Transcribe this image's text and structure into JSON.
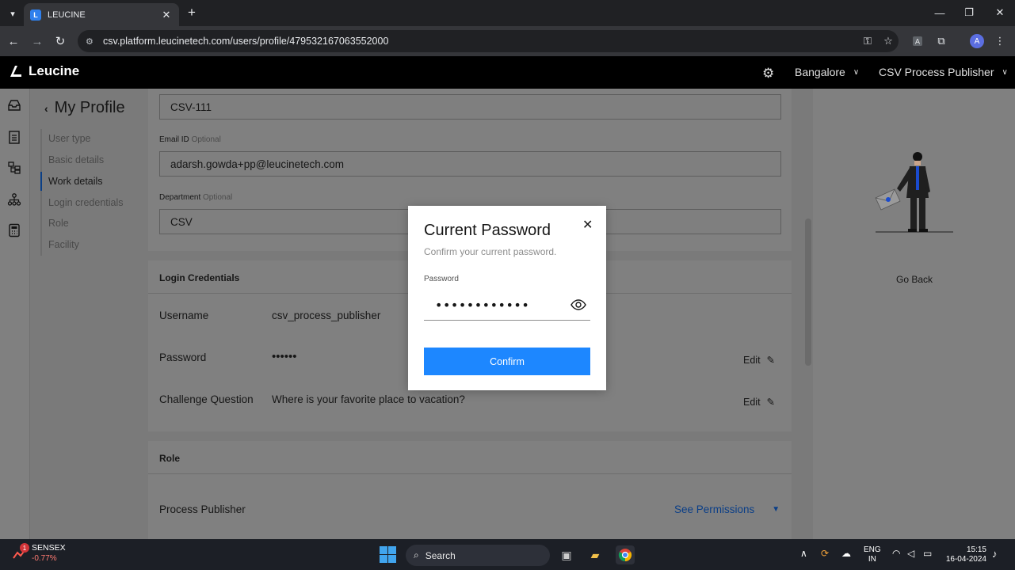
{
  "browser": {
    "tab_title": "LEUCINE",
    "tab_favicon": "L",
    "url": "csv.platform.leucinetech.com/users/profile/479532167063552000",
    "profile_initial": "A"
  },
  "header": {
    "brand": "Leucine",
    "facility": "Bangalore",
    "role_select": "CSV Process Publisher"
  },
  "left_nav": {
    "back_title": "My Profile",
    "items": [
      {
        "label": "User type"
      },
      {
        "label": "Basic details"
      },
      {
        "label": "Work details"
      },
      {
        "label": "Login credentials"
      },
      {
        "label": "Role"
      },
      {
        "label": "Facility"
      }
    ],
    "active": "Work details"
  },
  "work_details": {
    "employee_id_value": "CSV-111",
    "email_label": "Email ID",
    "email_optional": "Optional",
    "email_value": "adarsh.gowda+pp@leucinetech.com",
    "department_label": "Department",
    "department_optional": "Optional",
    "department_value": "CSV"
  },
  "login_credentials": {
    "title": "Login Credentials",
    "username_label": "Username",
    "username_value": "csv_process_publisher",
    "password_label": "Password",
    "password_value": "••••••",
    "password_edit": "Edit",
    "challenge_label": "Challenge Question",
    "challenge_value": "Where is your favorite place to vacation?",
    "challenge_edit": "Edit"
  },
  "role": {
    "title": "Role",
    "role_value": "Process Publisher",
    "see_permissions": "See Permissions"
  },
  "right_panel": {
    "go_back": "Go Back"
  },
  "modal": {
    "title": "Current Password",
    "subtitle": "Confirm your current password.",
    "password_label": "Password",
    "password_value": "••••••••••••",
    "confirm_label": "Confirm"
  },
  "taskbar": {
    "sensex_badge": "1",
    "sensex_name": "SENSEX",
    "sensex_change": "-0.77%",
    "search_placeholder": "Search",
    "lang_top": "ENG",
    "lang_bottom": "IN",
    "time": "15:15",
    "date": "16-04-2024"
  },
  "colors": {
    "primary": "#1d87ff",
    "header_bg": "#000000",
    "overlay": "#7a7a7a"
  }
}
